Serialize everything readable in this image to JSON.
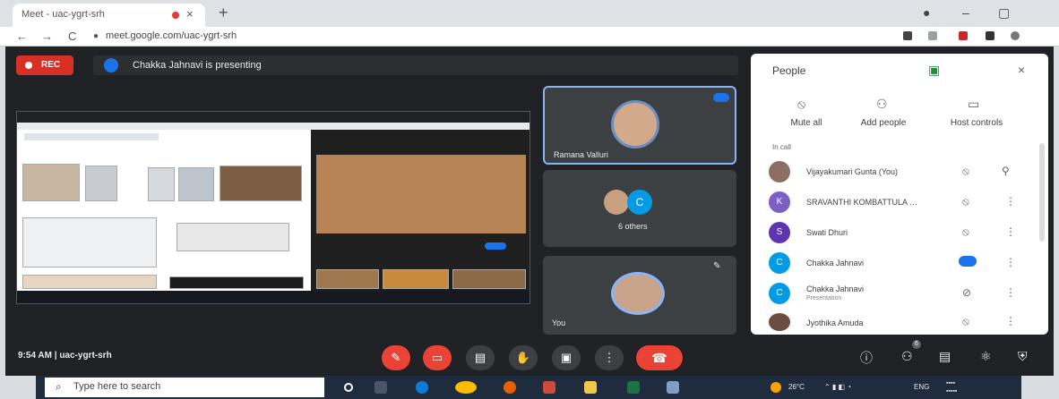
{
  "browser": {
    "tab_title": "Meet - uac-ygrt-srh",
    "tab_close": "×",
    "new_tab": "+",
    "url": "meet.google.com/uac-ygrt-srh",
    "nav": {
      "back": "←",
      "forward": "→",
      "reload": "C"
    }
  },
  "meet": {
    "rec_label": "REC",
    "presenting_text": "Chakka Jahnavi is presenting",
    "tiles": [
      {
        "name": "Ramana Valluri"
      },
      {
        "name": "6 others",
        "avatar_letter": "C"
      },
      {
        "name": "You"
      }
    ],
    "meeting_info": "9:54 AM  |  uac-ygrt-srh",
    "people_badge": "6"
  },
  "people_panel": {
    "title": "People",
    "close": "×",
    "actions": [
      {
        "label": "Mute all",
        "icon": "mic-off-icon"
      },
      {
        "label": "Add people",
        "icon": "person-add-icon"
      },
      {
        "label": "Host controls",
        "icon": "host-controls-icon"
      }
    ],
    "section_label": "In call",
    "participants": [
      {
        "name": "Vijayakumari Gunta (You)",
        "avatar_letter": "",
        "avatar_color": "#8d6e63",
        "sub": ""
      },
      {
        "name": "SRAVANTHI KOMBATTULA …",
        "avatar_letter": "K",
        "avatar_color": "#7b5fc4",
        "sub": ""
      },
      {
        "name": "Swati Dhuri",
        "avatar_letter": "S",
        "avatar_color": "#5e35b1",
        "sub": ""
      },
      {
        "name": "Chakka Jahnavi",
        "avatar_letter": "C",
        "avatar_color": "#039be5",
        "sub": ""
      },
      {
        "name": "Chakka Jahnavi",
        "avatar_letter": "C",
        "avatar_color": "#039be5",
        "sub": "Presentation"
      },
      {
        "name": "Jyothika Amuda",
        "avatar_letter": "",
        "avatar_color": "#6d4c41",
        "sub": ""
      }
    ]
  },
  "taskbar": {
    "search_placeholder": "Type here to search",
    "temp": "26°C",
    "lang": "ENG"
  },
  "colors": {
    "meet_bg": "#202124",
    "record_red": "#d93025",
    "accent_blue": "#1a73e8"
  }
}
